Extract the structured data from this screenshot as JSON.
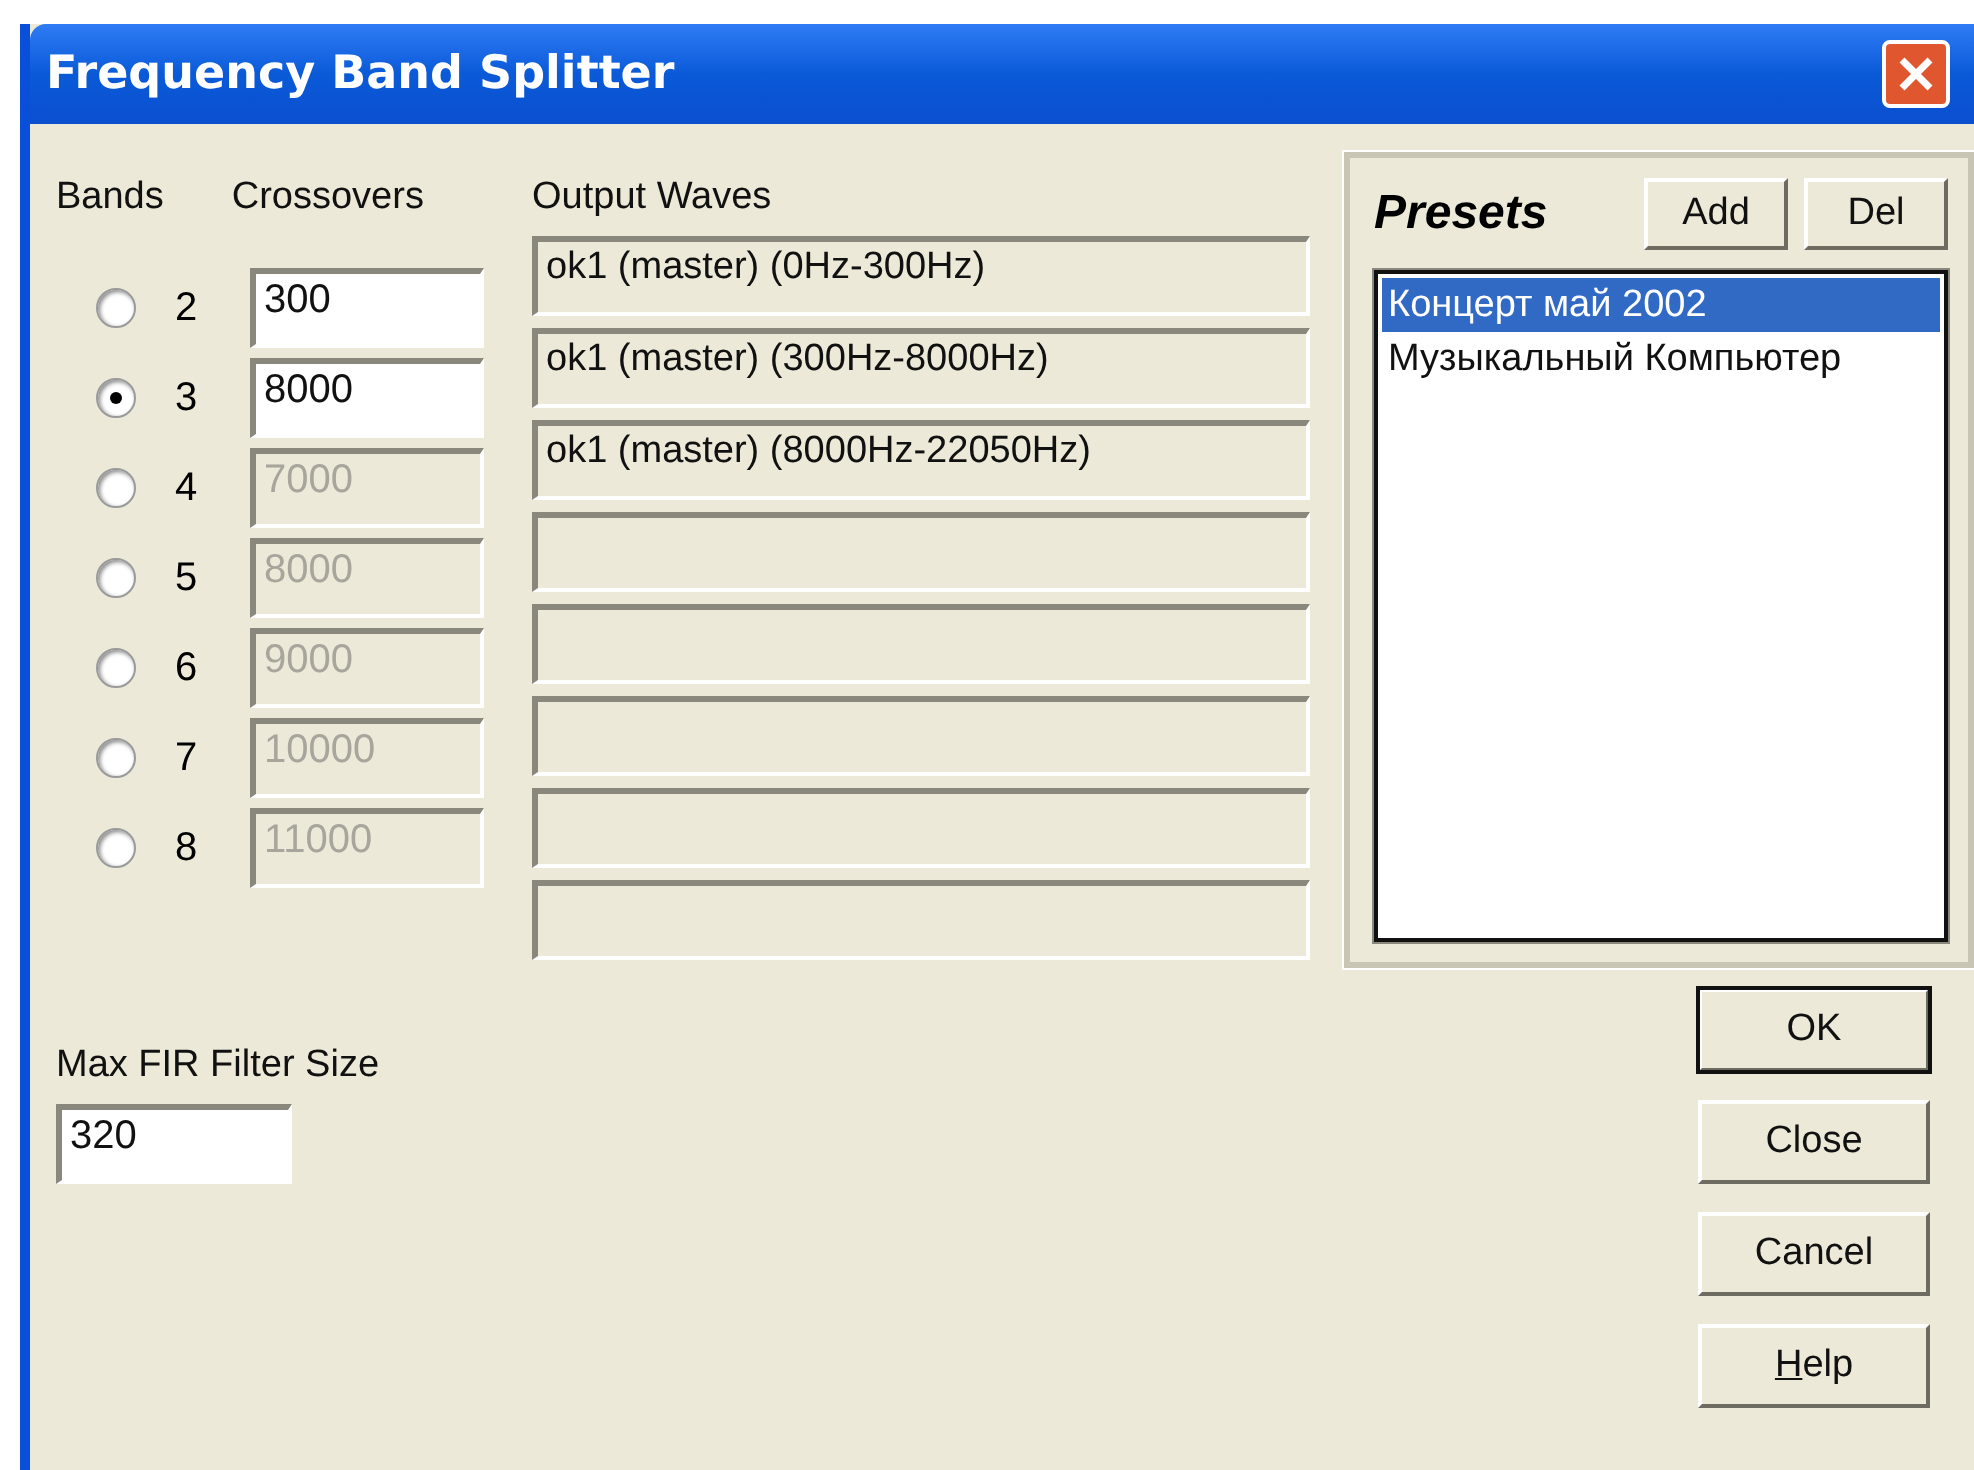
{
  "window": {
    "title": "Frequency Band Splitter"
  },
  "bands": {
    "label": "Bands",
    "crossovers_label": "Crossovers",
    "options": [
      {
        "label": "2",
        "selected": false,
        "crossover": "300",
        "disabled": false
      },
      {
        "label": "3",
        "selected": true,
        "crossover": "8000",
        "disabled": false
      },
      {
        "label": "4",
        "selected": false,
        "crossover": "7000",
        "disabled": true
      },
      {
        "label": "5",
        "selected": false,
        "crossover": "8000",
        "disabled": true
      },
      {
        "label": "6",
        "selected": false,
        "crossover": "9000",
        "disabled": true
      },
      {
        "label": "7",
        "selected": false,
        "crossover": "10000",
        "disabled": true
      },
      {
        "label": "8",
        "selected": false,
        "crossover": "11000",
        "disabled": true
      }
    ]
  },
  "output_waves": {
    "label": "Output Waves",
    "values": [
      "ok1 (master) (0Hz-300Hz)",
      "ok1 (master) (300Hz-8000Hz)",
      "ok1 (master) (8000Hz-22050Hz)"
    ]
  },
  "presets": {
    "title": "Presets",
    "buttons": [
      "Add",
      "Del"
    ],
    "items": [
      {
        "label": "Концерт май 2002",
        "selected": true
      },
      {
        "label": "Музыкальный Компьютер",
        "selected": false
      }
    ]
  },
  "max_fir": {
    "label": "Max FIR Filter Size",
    "value": "320"
  },
  "buttons": [
    {
      "label": "OK",
      "default": true
    },
    {
      "label": "Close",
      "default": false
    },
    {
      "label": "Cancel",
      "default": false
    },
    {
      "label": "Help",
      "default": false,
      "underline_first": true
    }
  ]
}
